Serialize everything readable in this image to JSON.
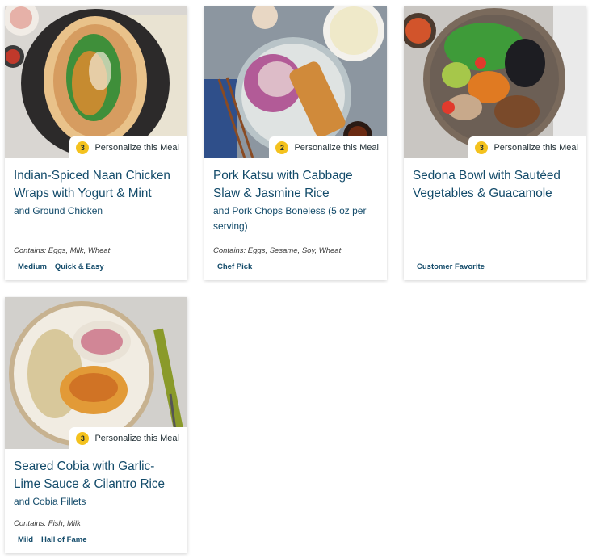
{
  "meals": [
    {
      "title": "Indian-Spiced Naan Chicken Wraps with Yogurt & Mint",
      "subtitle": "and Ground Chicken",
      "contains": "Contains: Eggs, Milk, Wheat",
      "tags": [
        "Medium",
        "Quick & Easy"
      ],
      "badge_count": "3",
      "badge_label": "Personalize this Meal",
      "image": "naan-wrap-photo"
    },
    {
      "title": "Pork Katsu with Cabbage Slaw & Jasmine Rice",
      "subtitle": "and Pork Chops Boneless (5 oz per serving)",
      "contains": "Contains: Eggs, Sesame, Soy, Wheat",
      "tags": [
        "Chef Pick"
      ],
      "badge_count": "2",
      "badge_label": "Personalize this Meal",
      "image": "pork-katsu-photo"
    },
    {
      "title": "Sedona Bowl with Sautéed Vegetables & Guacamole",
      "subtitle": "",
      "contains": "",
      "tags": [
        "Customer Favorite"
      ],
      "badge_count": "3",
      "badge_label": "Personalize this Meal",
      "image": "sedona-bowl-photo"
    },
    {
      "title": "Seared Cobia with Garlic-Lime Sauce & Cilantro Rice",
      "subtitle": "and Cobia Fillets",
      "contains": "Contains: Fish, Milk",
      "tags": [
        "Mild",
        "Hall of Fame"
      ],
      "badge_count": "3",
      "badge_label": "Personalize this Meal",
      "image": "seared-cobia-photo"
    }
  ]
}
